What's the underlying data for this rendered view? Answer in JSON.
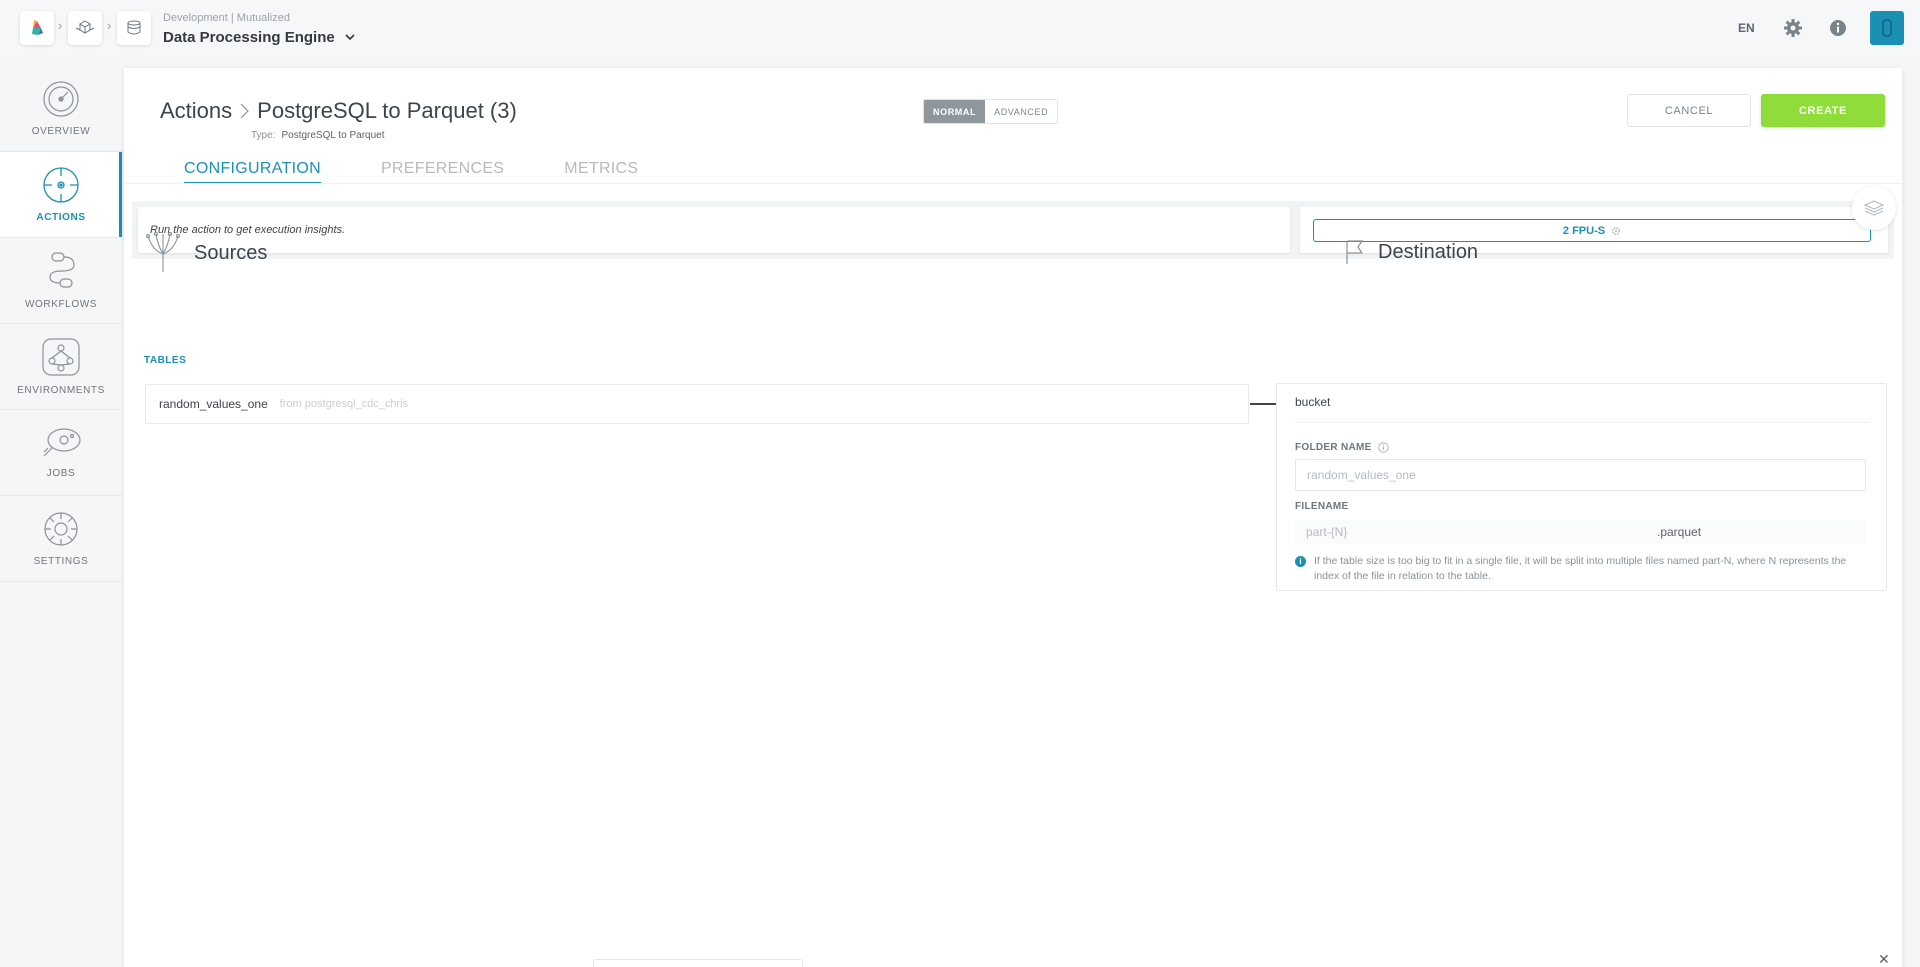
{
  "header": {
    "breadcrumb_icons": [
      "logo-icon",
      "cube-cluster-icon",
      "engine-icon"
    ],
    "subtitle": "Development | Mutualized",
    "title": "Data Processing Engine",
    "language": "EN"
  },
  "sidebar": {
    "items": [
      {
        "label": "OVERVIEW",
        "icon": "gauge-icon",
        "active": false
      },
      {
        "label": "ACTIONS",
        "icon": "target-icon",
        "active": true
      },
      {
        "label": "WORKFLOWS",
        "icon": "workflow-icon",
        "active": false
      },
      {
        "label": "ENVIRONMENTS",
        "icon": "network-icon",
        "active": false
      },
      {
        "label": "JOBS",
        "icon": "satellite-icon",
        "active": false
      },
      {
        "label": "SETTINGS",
        "icon": "cog-icon",
        "active": false
      }
    ]
  },
  "action": {
    "root": "Actions",
    "name": "PostgreSQL to Parquet (3)",
    "type_label": "Type:",
    "type_value": "PostgreSQL to Parquet",
    "mode_normal": "NORMAL",
    "mode_advanced": "ADVANCED",
    "cancel": "CANCEL",
    "create": "CREATE"
  },
  "tabs": [
    "CONFIGURATION",
    "PREFERENCES",
    "METRICS"
  ],
  "insights": {
    "message": "Run the action to get execution insights.",
    "fpu": "2 FPU-S"
  },
  "sources": {
    "title": "Sources",
    "tables_label": "TABLES",
    "table_name": "random_values_one",
    "table_from": "from postgresql_cdc_chris"
  },
  "destination": {
    "title": "Destination",
    "name": "bucket",
    "folder_label": "FOLDER NAME",
    "folder_placeholder": "random_values_one",
    "filename_label": "FILENAME",
    "filename_placeholder": "part-{N}",
    "extension": ".parquet",
    "note": "If the table size is too big to fit in a single file, it will be split into multiple files named part-N, where N represents the index of the file in relation to the table."
  },
  "colors": {
    "accent": "#1b8fb4",
    "create": "#8fdc3a"
  }
}
